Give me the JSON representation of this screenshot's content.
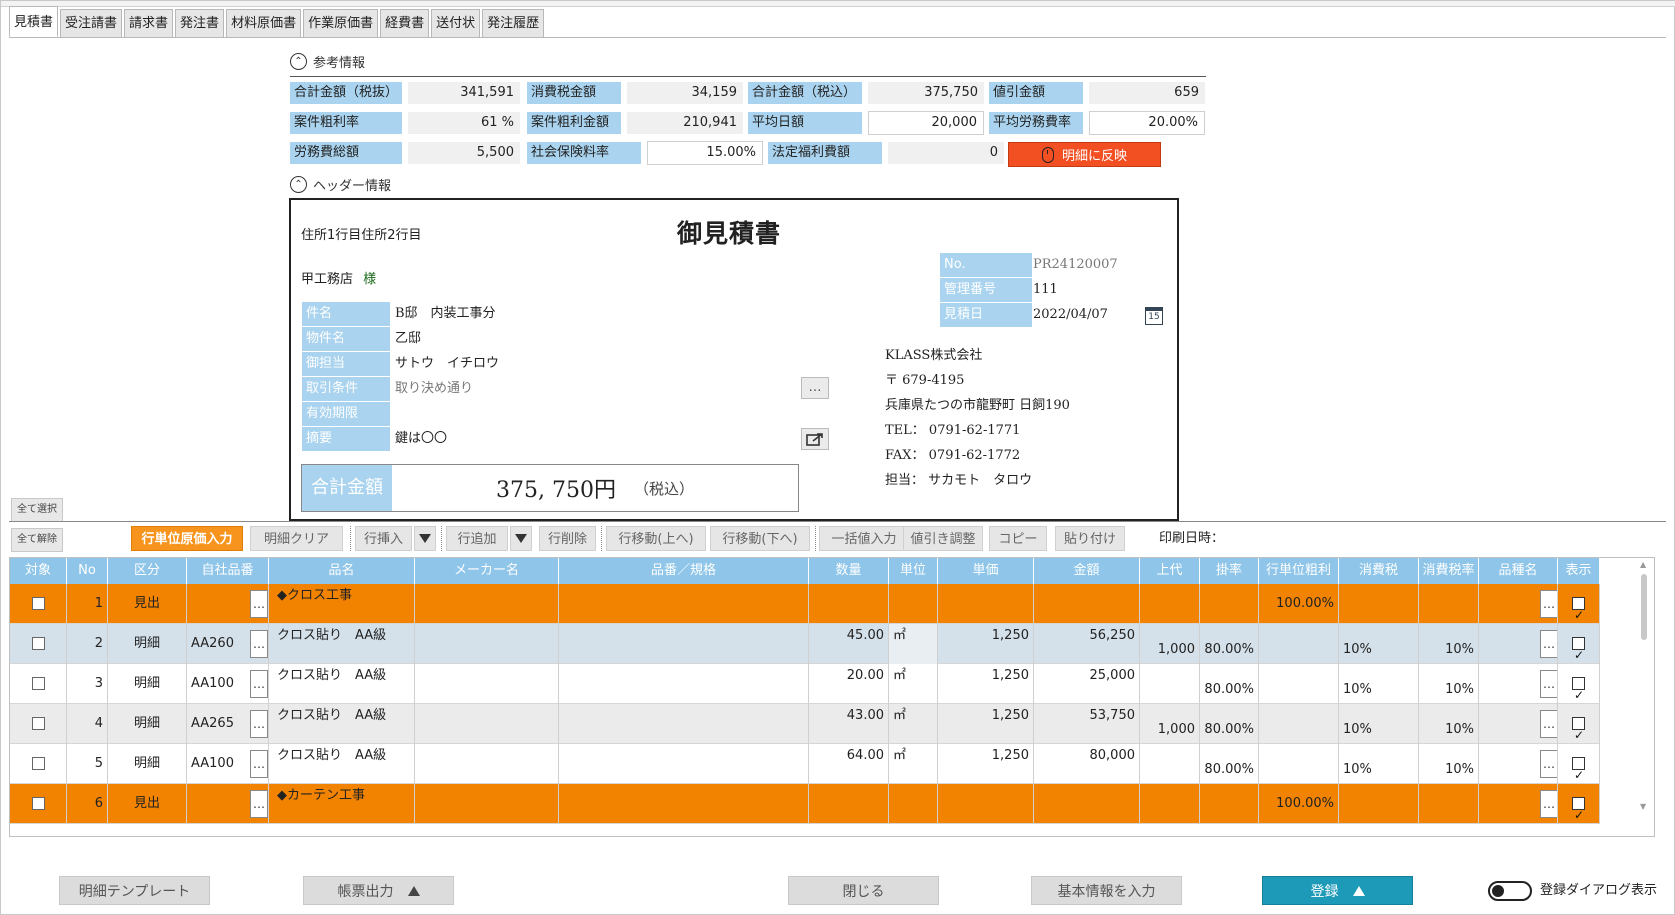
{
  "tabs": [
    "見積書",
    "受注請書",
    "請求書",
    "発注書",
    "材料原価書",
    "作業原価書",
    "経費書",
    "送付状",
    "発注履歴"
  ],
  "reference": {
    "title": "参考情報",
    "collapse_glyph": "⌃",
    "total_excl_label": "合計金額（税抜）",
    "total_excl": "341,591",
    "tax_label": "消費税金額",
    "tax": "34,159",
    "total_incl_label": "合計金額（税込）",
    "total_incl": "375,750",
    "discount_label": "値引金額",
    "discount": "659",
    "gross_rate_label": "案件粗利率",
    "gross_rate": "61 %",
    "gross_amount_label": "案件粗利金額",
    "gross_amount": "210,941",
    "avg_daily_label": "平均日額",
    "avg_daily": "20,000",
    "avg_labor_rate_label": "平均労務費率",
    "avg_labor_rate": "20.00%",
    "labor_total_label": "労務費総額",
    "labor_total": "5,500",
    "social_ins_label": "社会保険料率",
    "social_ins": "15.00%",
    "welfare_label": "法定福利費額",
    "welfare": "0",
    "reflect_button": "明細に反映"
  },
  "header_info": {
    "title": "ヘッダー情報",
    "address": "住所1行目住所2行目",
    "doc_title": "御見積書",
    "customer": "甲工務店",
    "honorific": "様",
    "fields": [
      {
        "label": "件名",
        "value": "B邸　内装工事分"
      },
      {
        "label": "物件名",
        "value": "乙邸"
      },
      {
        "label": "御担当",
        "value": "サトウ　イチロウ"
      },
      {
        "label": "取引条件",
        "value": "取り決め通り"
      },
      {
        "label": "有効期限",
        "value": ""
      },
      {
        "label": "摘要",
        "value": "鍵は〇〇"
      }
    ],
    "no_label": "No.",
    "no_value": "PR24120007",
    "mgmt_label": "管理番号",
    "mgmt_value": "111",
    "date_label": "見積日",
    "date_value": "2022/04/07",
    "calendar_day": "15",
    "dots": "…",
    "company": {
      "name": "KLASS株式会社",
      "zip": "〒 679-4195",
      "address": "兵庫県たつの市龍野町 日飼190",
      "tel": "TEL： 0791-62-1771",
      "fax": "FAX： 0791-62-1772",
      "rep": "担当： サカモト　タロウ"
    },
    "total_label": "合計金額",
    "total_amount": "375, 750円",
    "total_tax": "（税込）"
  },
  "side_buttons": {
    "select_all": "全て選択",
    "deselect_all": "全て解除"
  },
  "toolbar": {
    "unit_cost": "行単位原価入力",
    "clear": "明細クリア",
    "insert": "行挿入",
    "add": "行追加",
    "delete": "行削除",
    "move_up": "行移動(上へ)",
    "move_down": "行移動(下へ)",
    "bulk": "一括値入力",
    "discount_adjust": "値引き調整",
    "copy": "コピー",
    "paste": "貼り付け",
    "print_datetime": "印刷日時："
  },
  "grid": {
    "columns": [
      "対象",
      "No",
      "区分",
      "自社品番",
      "品名",
      "メーカー名",
      "品番／規格",
      "数量",
      "単位",
      "単価",
      "金額",
      "上代",
      "掛率",
      "行単位粗利",
      "消費税",
      "消費税率",
      "品種名",
      "表示"
    ],
    "rows": [
      {
        "style": "heading",
        "no": "1",
        "kubun": "見出",
        "code": "",
        "name": "◆クロス工事",
        "maker": "",
        "spec": "",
        "qty": "",
        "unit": "",
        "price": "",
        "amount": "",
        "retail": "",
        "rate": "",
        "margin": "100.00%",
        "tax": "",
        "taxrate": "",
        "kind": "",
        "checked": false,
        "show": true
      },
      {
        "style": "sel",
        "no": "2",
        "kubun": "明細",
        "code": "AA260",
        "name": "クロス貼り　AA級",
        "maker": "",
        "spec": "",
        "qty": "45.00",
        "unit": "㎡",
        "price": "1,250",
        "amount": "56,250",
        "retail": "1,000",
        "rate": "80.00%",
        "margin": "",
        "tax": "10%",
        "taxrate": "10%",
        "kind": "",
        "checked": false,
        "show": true
      },
      {
        "style": "white",
        "no": "3",
        "kubun": "明細",
        "code": "AA100",
        "name": "クロス貼り　AA級",
        "maker": "",
        "spec": "",
        "qty": "20.00",
        "unit": "㎡",
        "price": "1,250",
        "amount": "25,000",
        "retail": "",
        "rate": "80.00%",
        "margin": "",
        "tax": "10%",
        "taxrate": "10%",
        "kind": "",
        "checked": false,
        "show": true
      },
      {
        "style": "gray",
        "no": "4",
        "kubun": "明細",
        "code": "AA265",
        "name": "クロス貼り　AA級",
        "maker": "",
        "spec": "",
        "qty": "43.00",
        "unit": "㎡",
        "price": "1,250",
        "amount": "53,750",
        "retail": "1,000",
        "rate": "80.00%",
        "margin": "",
        "tax": "10%",
        "taxrate": "10%",
        "kind": "",
        "checked": false,
        "show": true
      },
      {
        "style": "white",
        "no": "5",
        "kubun": "明細",
        "code": "AA100",
        "name": "クロス貼り　AA級",
        "maker": "",
        "spec": "",
        "qty": "64.00",
        "unit": "㎡",
        "price": "1,250",
        "amount": "80,000",
        "retail": "",
        "rate": "80.00%",
        "margin": "",
        "tax": "10%",
        "taxrate": "10%",
        "kind": "",
        "checked": false,
        "show": true
      },
      {
        "style": "heading",
        "no": "6",
        "kubun": "見出",
        "code": "",
        "name": "◆カーテン工事",
        "maker": "",
        "spec": "",
        "qty": "",
        "unit": "",
        "price": "",
        "amount": "",
        "retail": "",
        "rate": "",
        "margin": "100.00%",
        "tax": "",
        "taxrate": "",
        "kind": "",
        "checked": false,
        "show": true
      }
    ]
  },
  "bottom": {
    "template": "明細テンプレート",
    "output": "帳票出力",
    "close": "閉じる",
    "basic_info": "基本情報を入力",
    "register": "登録",
    "toggle_label": "登録ダイアログ表示"
  },
  "colors": {
    "accent_blue": "#a9d3ee",
    "heading_row": "#f28300",
    "primary": "#1e9ab9",
    "reflect": "#f25022"
  }
}
